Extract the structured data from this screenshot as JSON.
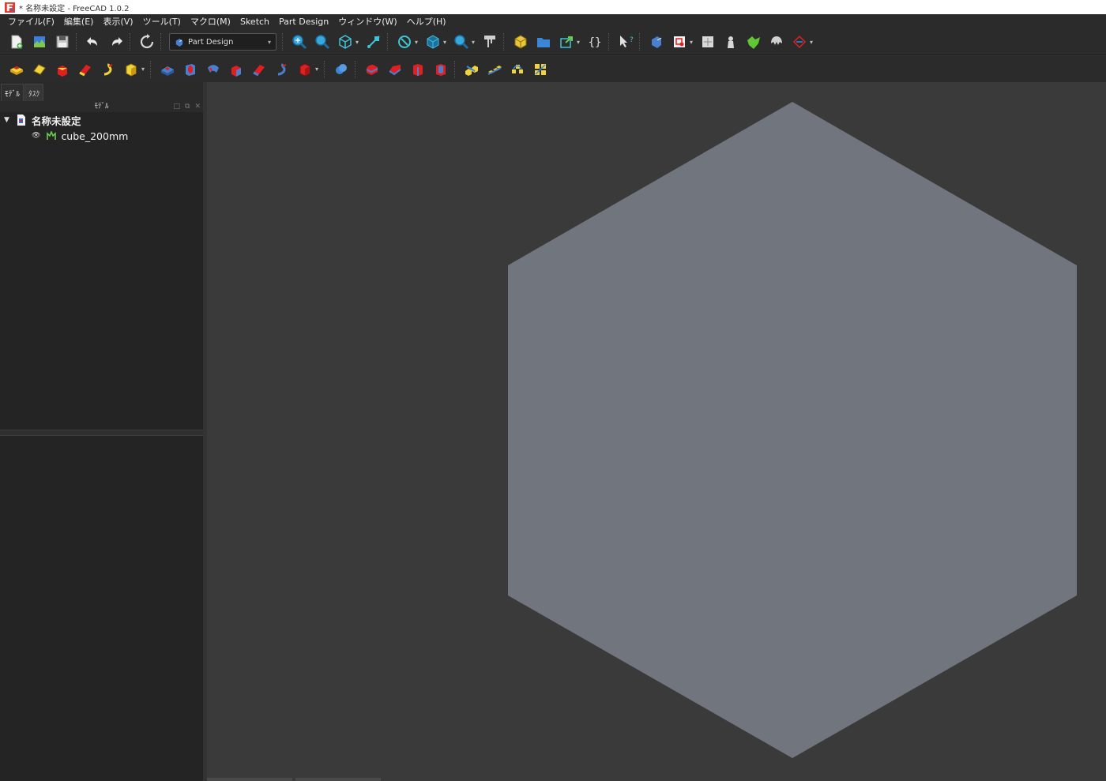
{
  "window": {
    "title": "* 名称未設定 - FreeCAD 1.0.2",
    "app_icon": "freecad-icon"
  },
  "menu": [
    "ファイル(F)",
    "編集(E)",
    "表示(V)",
    "ツール(T)",
    "マクロ(M)",
    "Sketch",
    "Part Design",
    "ウィンドウ(W)",
    "ヘルプ(H)"
  ],
  "workbench": {
    "selected": "Part Design"
  },
  "left_panel": {
    "tabs": [
      "ﾓﾃﾞﾙ",
      "ﾀｽｸ"
    ],
    "header": "ﾓﾃﾞﾙ",
    "tree": {
      "document": "名称未設定",
      "children": [
        "cube_200mm"
      ]
    }
  },
  "colors": {
    "viewport_bg": "#3a3a3a",
    "cube_face": "#71767e",
    "panel_bg": "#2a2a2a"
  }
}
